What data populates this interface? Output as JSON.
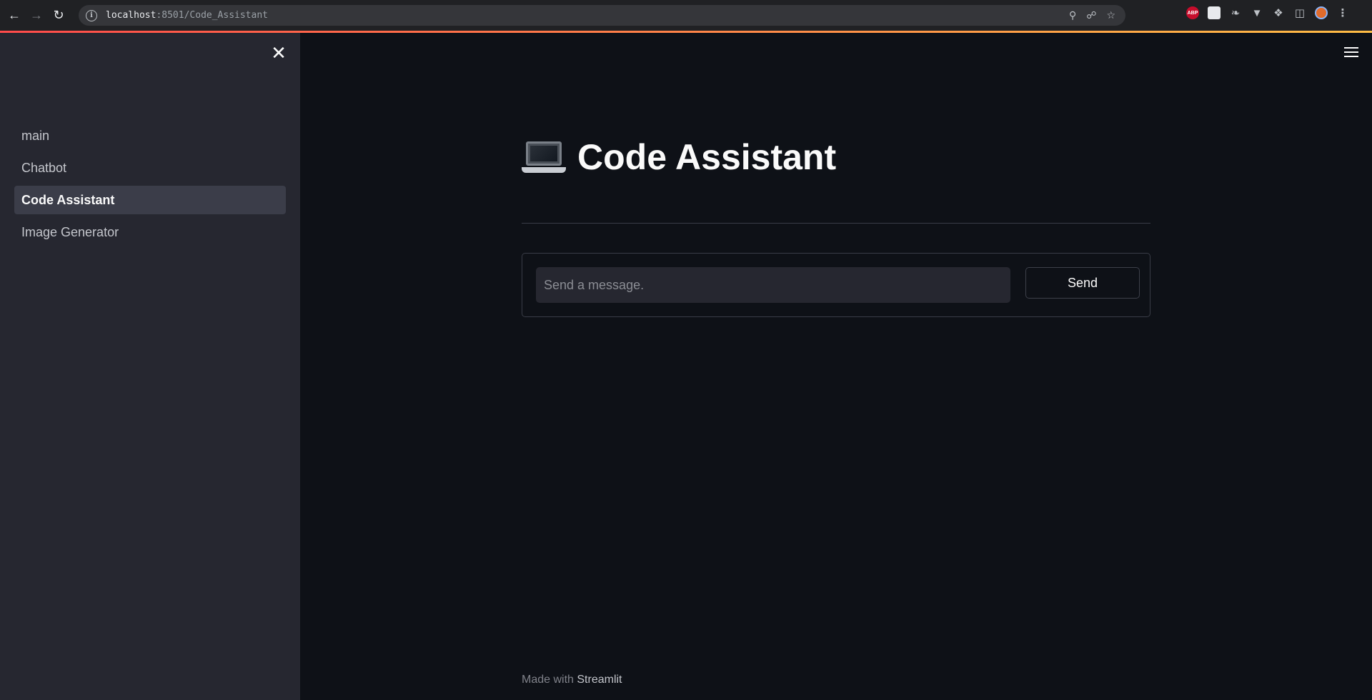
{
  "browser": {
    "url_host": "localhost",
    "url_rest": ":8501/Code_Assistant",
    "extensions": [
      "ABP"
    ]
  },
  "sidebar": {
    "items": [
      {
        "label": "main",
        "active": false
      },
      {
        "label": "Chatbot",
        "active": false
      },
      {
        "label": "Code Assistant",
        "active": true
      },
      {
        "label": "Image Generator",
        "active": false
      }
    ]
  },
  "main": {
    "title": "Code Assistant",
    "title_icon": "laptop-icon",
    "form": {
      "input_placeholder": "Send a message.",
      "input_value": "",
      "send_label": "Send"
    }
  },
  "footer": {
    "prefix": "Made with",
    "brand": "Streamlit"
  },
  "colors": {
    "background": "#0e1117",
    "sidebar": "#262730",
    "accent_start": "#ff4b4b",
    "accent_end": "#ffbd45"
  }
}
